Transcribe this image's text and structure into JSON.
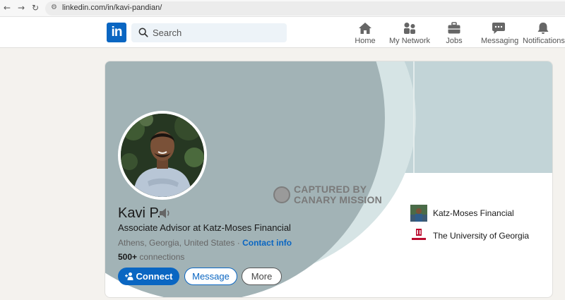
{
  "browser": {
    "url": "linkedin.com/in/kavi-pandian/",
    "back_glyph": "←",
    "forward_glyph": "→",
    "reload_glyph": "↻",
    "site_settings_glyph": "⚙"
  },
  "header": {
    "logo_text": "in",
    "search_placeholder": "Search",
    "nav": [
      {
        "label": "Home",
        "icon": "home-icon"
      },
      {
        "label": "My Network",
        "icon": "people-icon"
      },
      {
        "label": "Jobs",
        "icon": "briefcase-icon"
      },
      {
        "label": "Messaging",
        "icon": "chat-icon"
      },
      {
        "label": "Notifications",
        "icon": "bell-icon"
      }
    ]
  },
  "watermark": {
    "line1": "CAPTURED BY",
    "line2": "CANARY MISSION"
  },
  "profile": {
    "name": "Kavi P.",
    "headline": "Associate Advisor at Katz-Moses Financial",
    "location": "Athens, Georgia, United States",
    "separator": " · ",
    "contact_label": "Contact info",
    "connections_count": "500+",
    "connections_label": " connections"
  },
  "actions": {
    "connect_label": "Connect",
    "message_label": "Message",
    "more_label": "More"
  },
  "organizations": [
    {
      "name": "Katz-Moses Financial",
      "logo": "company-logo"
    },
    {
      "name": "The University of Georgia",
      "logo": "university-logo"
    }
  ],
  "colors": {
    "brand": "#0a66c2",
    "banner": "#a2b3b6",
    "page_bg": "#f4f2ee"
  }
}
